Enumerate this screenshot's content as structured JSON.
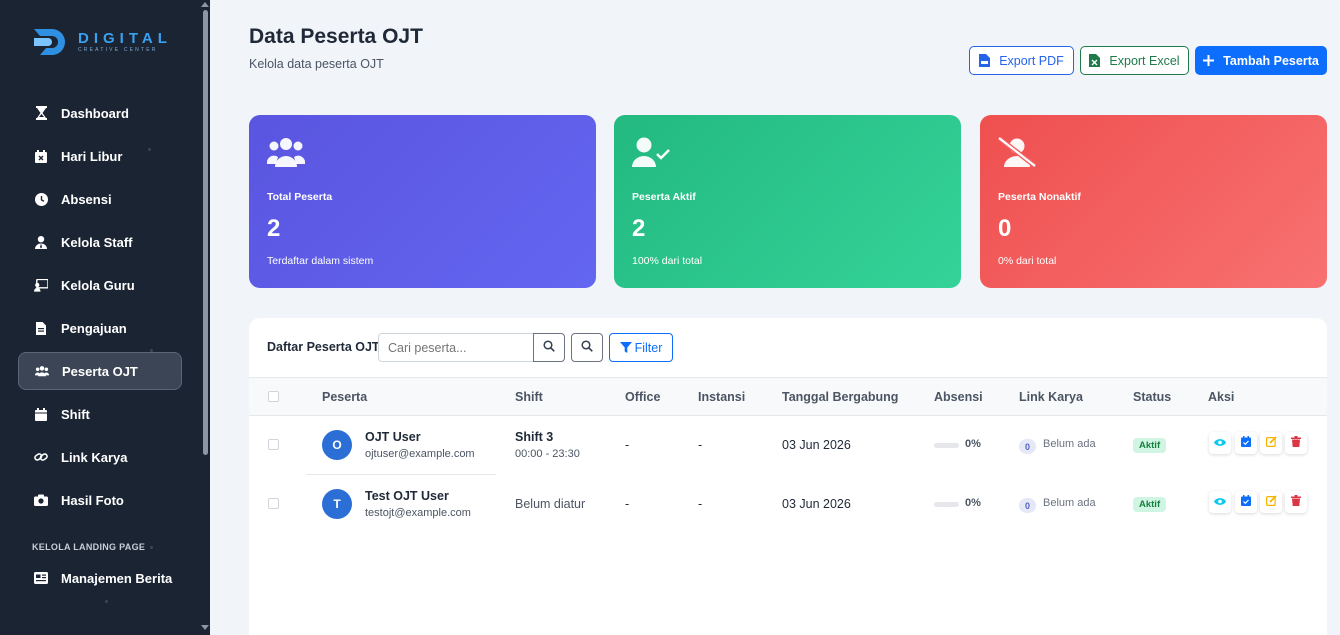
{
  "brand": {
    "name": "DIGITAL",
    "tagline": "CREATIVE CENTER"
  },
  "sidebar": {
    "items": [
      {
        "label": "Dashboard",
        "icon": "hourglass-icon"
      },
      {
        "label": "Hari Libur",
        "icon": "calendar-x-icon"
      },
      {
        "label": "Absensi",
        "icon": "clock-icon"
      },
      {
        "label": "Kelola Staff",
        "icon": "user-tie-icon"
      },
      {
        "label": "Kelola Guru",
        "icon": "teacher-icon"
      },
      {
        "label": "Pengajuan",
        "icon": "file-icon"
      },
      {
        "label": "Peserta OJT",
        "icon": "users-icon",
        "active": true
      },
      {
        "label": "Shift",
        "icon": "calendar-icon"
      },
      {
        "label": "Link Karya",
        "icon": "link-icon"
      },
      {
        "label": "Hasil Foto",
        "icon": "camera-icon"
      }
    ],
    "section_label": "KELOLA LANDING PAGE",
    "section_items": [
      {
        "label": "Manajemen Berita",
        "icon": "newspaper-icon"
      }
    ]
  },
  "header": {
    "title": "Data Peserta OJT",
    "subtitle": "Kelola data peserta OJT",
    "export_pdf": "Export PDF",
    "export_excel": "Export Excel",
    "add_button": "Tambah Peserta"
  },
  "stats": [
    {
      "title": "Total Peserta",
      "value": "2",
      "desc": "Terdaftar dalam sistem",
      "color": "#5a55e0"
    },
    {
      "title": "Peserta Aktif",
      "value": "2",
      "desc": "100% dari total",
      "color": "#23b981"
    },
    {
      "title": "Peserta Nonaktif",
      "value": "0",
      "desc": "0% dari total",
      "color": "#ef4f4f"
    }
  ],
  "table": {
    "title": "Daftar Peserta OJT",
    "search_placeholder": "Cari peserta...",
    "filter_label": "Filter",
    "columns": [
      "Peserta",
      "Shift",
      "Office",
      "Instansi",
      "Tanggal Bergabung",
      "Absensi",
      "Link Karya",
      "Status",
      "Aksi"
    ],
    "rows": [
      {
        "initial": "O",
        "name": "OJT User",
        "email": "ojtuser@example.com",
        "shift_name": "Shift 3",
        "shift_time": "00:00 - 23:30",
        "office": "-",
        "instansi": "-",
        "joined": "03 Jun 2026",
        "attendance_pct": "0%",
        "attendance_fraction": 0,
        "link_count": "0",
        "link_text": "Belum ada",
        "status": "Aktif"
      },
      {
        "initial": "T",
        "name": "Test OJT User",
        "email": "testojt@example.com",
        "shift_name": "Belum diatur",
        "shift_time": "",
        "office": "-",
        "instansi": "-",
        "joined": "03 Jun 2026",
        "attendance_pct": "0%",
        "attendance_fraction": 0,
        "link_count": "0",
        "link_text": "Belum ada",
        "status": "Aktif"
      }
    ]
  }
}
